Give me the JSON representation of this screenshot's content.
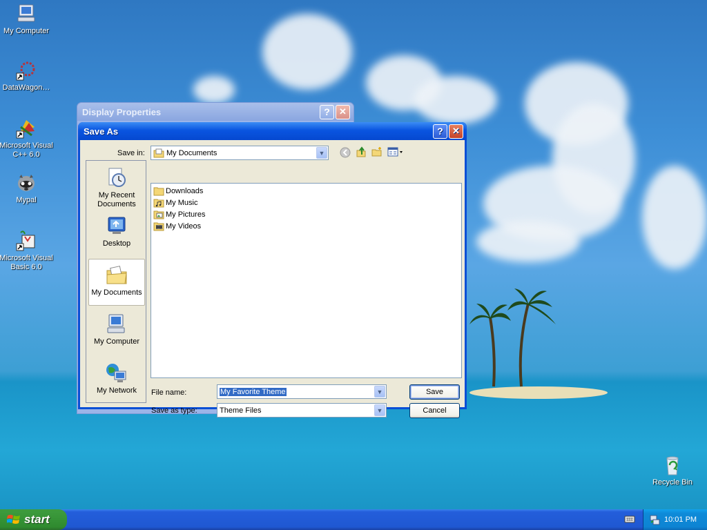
{
  "desktop": {
    "icons": [
      {
        "label": "My Computer",
        "icon": "my-computer-icon"
      },
      {
        "label": "DataWagon…",
        "icon": "datawagon-icon"
      },
      {
        "label": "Microsoft Visual C++ 6.0",
        "icon": "visual-cpp-icon"
      },
      {
        "label": "Mypal",
        "icon": "mypal-icon"
      },
      {
        "label": "Microsoft Visual Basic 6.0",
        "icon": "visual-basic-icon"
      }
    ],
    "recycle_bin": {
      "label": "Recycle Bin",
      "icon": "recycle-bin-icon"
    }
  },
  "display_properties": {
    "title": "Display Properties"
  },
  "save_as": {
    "title": "Save As",
    "save_in_label": "Save in:",
    "save_in_value": "My Documents",
    "places": [
      {
        "label": "My Recent Documents",
        "icon": "recent-documents-icon"
      },
      {
        "label": "Desktop",
        "icon": "desktop-icon"
      },
      {
        "label": "My Documents",
        "icon": "my-documents-icon",
        "selected": true
      },
      {
        "label": "My Computer",
        "icon": "my-computer-icon"
      },
      {
        "label": "My Network",
        "icon": "my-network-icon"
      }
    ],
    "files": [
      {
        "name": "Downloads",
        "icon": "folder-icon"
      },
      {
        "name": "My Music",
        "icon": "music-folder-icon"
      },
      {
        "name": "My Pictures",
        "icon": "pictures-folder-icon"
      },
      {
        "name": "My Videos",
        "icon": "videos-folder-icon"
      }
    ],
    "file_name_label": "File name:",
    "file_name_value": "My Favorite Theme",
    "save_as_type_label": "Save as type:",
    "save_as_type_value": "Theme Files",
    "save_button": "Save",
    "cancel_button": "Cancel"
  },
  "taskbar": {
    "start_label": "start",
    "clock": "10:01 PM"
  },
  "colors": {
    "title_bar": "#0a55e0",
    "start_green": "#3c9a3c",
    "taskbar_blue": "#245edb",
    "selection": "#316ac5"
  }
}
